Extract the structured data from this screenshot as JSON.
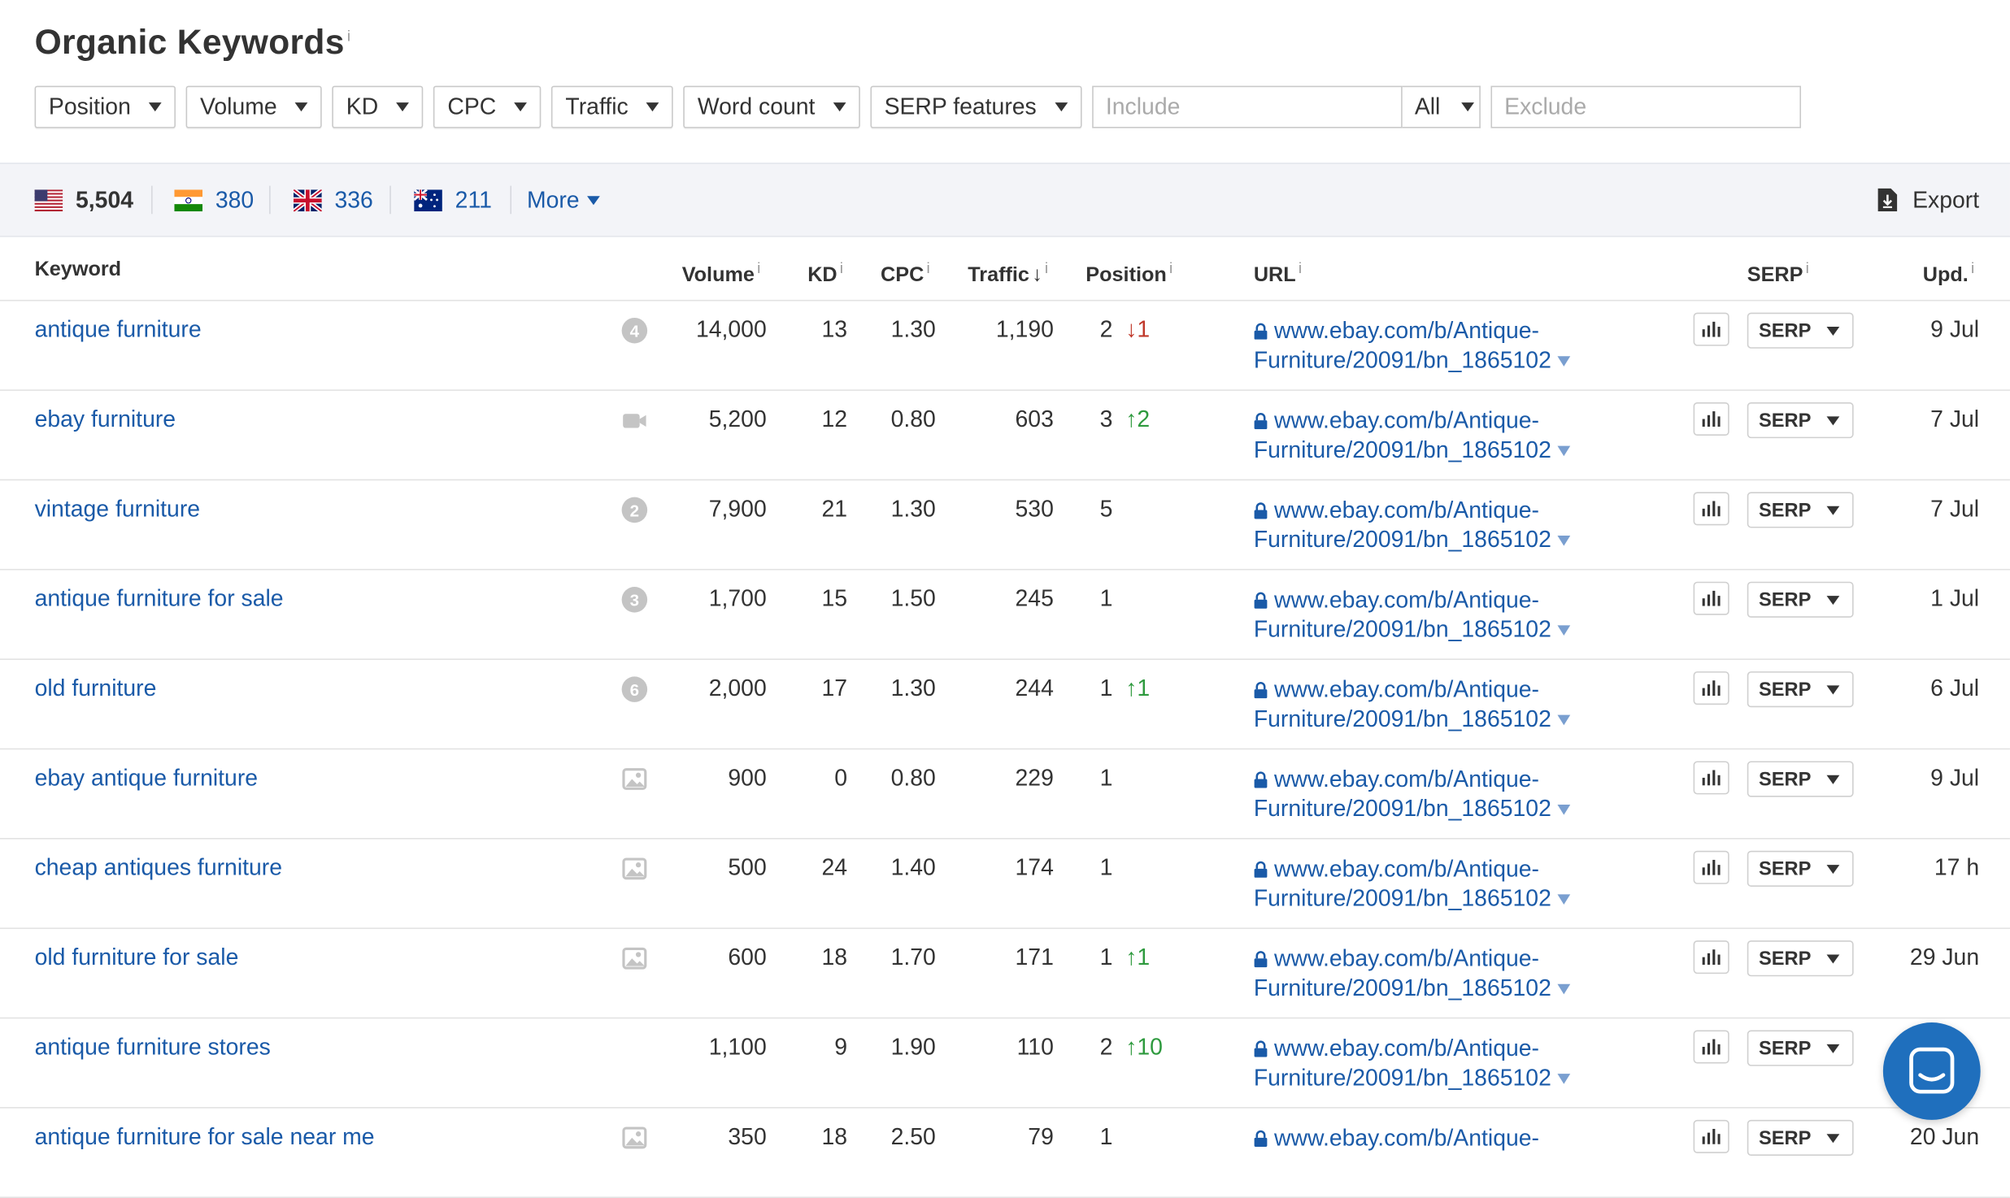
{
  "title": "Organic Keywords",
  "info_marker": "i",
  "filters": {
    "buttons": [
      "Position",
      "Volume",
      "KD",
      "CPC",
      "Traffic",
      "Word count",
      "SERP features"
    ],
    "include_placeholder": "Include",
    "all_label": "All",
    "exclude_placeholder": "Exclude"
  },
  "countries": [
    {
      "flag": "us-flag",
      "count": "5,504"
    },
    {
      "flag": "in-flag",
      "count": "380"
    },
    {
      "flag": "gb-flag",
      "count": "336"
    },
    {
      "flag": "au-flag",
      "count": "211"
    }
  ],
  "more_label": "More",
  "export_label": "Export",
  "columns": {
    "keyword": "Keyword",
    "volume": "Volume",
    "kd": "KD",
    "cpc": "CPC",
    "traffic": "Traffic",
    "position": "Position",
    "url": "URL",
    "serp": "SERP",
    "updated": "Upd."
  },
  "serp_button_label": "SERP",
  "rows": [
    {
      "keyword": "antique furniture",
      "feature": "4",
      "volume": "14,000",
      "kd": "13",
      "cpc": "1.30",
      "traffic": "1,190",
      "position": "2",
      "change": "1",
      "dir": "down",
      "url1": "www.ebay.com/b/Antique-",
      "url2": "Furniture/20091/bn_1865102",
      "updated": "9 Jul"
    },
    {
      "keyword": "ebay furniture",
      "feature": "video",
      "volume": "5,200",
      "kd": "12",
      "cpc": "0.80",
      "traffic": "603",
      "position": "3",
      "change": "2",
      "dir": "up",
      "url1": "www.ebay.com/b/Antique-",
      "url2": "Furniture/20091/bn_1865102",
      "updated": "7 Jul"
    },
    {
      "keyword": "vintage furniture",
      "feature": "2",
      "volume": "7,900",
      "kd": "21",
      "cpc": "1.30",
      "traffic": "530",
      "position": "5",
      "change": "",
      "dir": "",
      "url1": "www.ebay.com/b/Antique-",
      "url2": "Furniture/20091/bn_1865102",
      "updated": "7 Jul"
    },
    {
      "keyword": "antique furniture for sale",
      "feature": "3",
      "volume": "1,700",
      "kd": "15",
      "cpc": "1.50",
      "traffic": "245",
      "position": "1",
      "change": "",
      "dir": "",
      "url1": "www.ebay.com/b/Antique-",
      "url2": "Furniture/20091/bn_1865102",
      "updated": "1 Jul"
    },
    {
      "keyword": "old furniture",
      "feature": "6",
      "volume": "2,000",
      "kd": "17",
      "cpc": "1.30",
      "traffic": "244",
      "position": "1",
      "change": "1",
      "dir": "up",
      "url1": "www.ebay.com/b/Antique-",
      "url2": "Furniture/20091/bn_1865102",
      "updated": "6 Jul"
    },
    {
      "keyword": "ebay antique furniture",
      "feature": "image",
      "volume": "900",
      "kd": "0",
      "cpc": "0.80",
      "traffic": "229",
      "position": "1",
      "change": "",
      "dir": "",
      "url1": "www.ebay.com/b/Antique-",
      "url2": "Furniture/20091/bn_1865102",
      "updated": "9 Jul"
    },
    {
      "keyword": "cheap antiques furniture",
      "feature": "image",
      "volume": "500",
      "kd": "24",
      "cpc": "1.40",
      "traffic": "174",
      "position": "1",
      "change": "",
      "dir": "",
      "url1": "www.ebay.com/b/Antique-",
      "url2": "Furniture/20091/bn_1865102",
      "updated": "17 h"
    },
    {
      "keyword": "old furniture for sale",
      "feature": "image",
      "volume": "600",
      "kd": "18",
      "cpc": "1.70",
      "traffic": "171",
      "position": "1",
      "change": "1",
      "dir": "up",
      "url1": "www.ebay.com/b/Antique-",
      "url2": "Furniture/20091/bn_1865102",
      "updated": "29 Jun"
    },
    {
      "keyword": "antique furniture stores",
      "feature": "",
      "volume": "1,100",
      "kd": "9",
      "cpc": "1.90",
      "traffic": "110",
      "position": "2",
      "change": "10",
      "dir": "up",
      "url1": "www.ebay.com/b/Antique-",
      "url2": "Furniture/20091/bn_1865102",
      "updated": ""
    },
    {
      "keyword": "antique furniture for sale near me",
      "feature": "image",
      "volume": "350",
      "kd": "18",
      "cpc": "2.50",
      "traffic": "79",
      "position": "1",
      "change": "",
      "dir": "",
      "url1": "www.ebay.com/b/Antique-",
      "url2": "",
      "updated": "20 Jun"
    }
  ]
}
